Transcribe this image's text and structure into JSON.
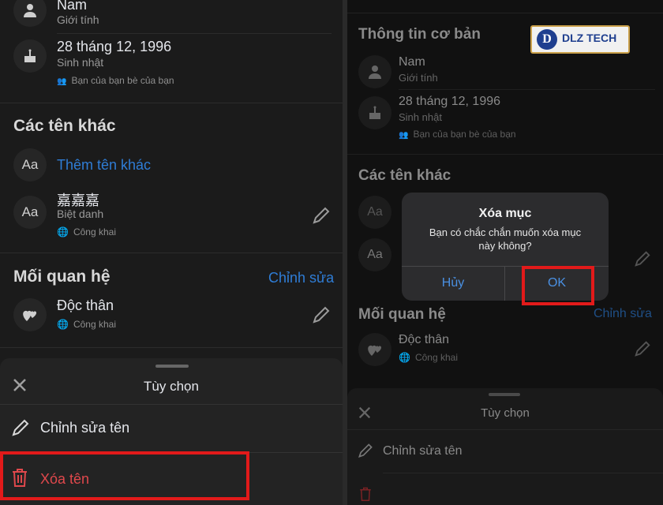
{
  "left": {
    "gender": {
      "value": "Nam",
      "label": "Giới tính"
    },
    "birthday": {
      "value": "28 tháng 12, 1996",
      "label": "Sinh nhật",
      "privacy": "Bạn của bạn bè của bạn"
    },
    "other_names": {
      "title": "Các tên khác",
      "add_label": "Thêm tên khác",
      "nickname": {
        "value": "嘉嘉嘉",
        "label": "Biệt danh",
        "privacy": "Công khai"
      }
    },
    "relationship": {
      "title": "Mối quan hệ",
      "edit_label": "Chỉnh sửa",
      "value": "Độc thân",
      "privacy": "Công khai"
    },
    "sheet": {
      "title": "Tùy chọn",
      "edit_name": "Chỉnh sửa tên",
      "delete_name": "Xóa tên"
    }
  },
  "right": {
    "logo_text": "DLZ TECH",
    "basic_info_title": "Thông tin cơ bản",
    "gender": {
      "value": "Nam",
      "label": "Giới tính"
    },
    "birthday": {
      "value": "28 tháng 12, 1996",
      "label": "Sinh nhật",
      "privacy": "Bạn của bạn bè của bạn"
    },
    "other_names_title": "Các tên khác",
    "relationship": {
      "title": "Mối quan hệ",
      "edit_label": "Chỉnh sửa",
      "value": "Độc thân",
      "privacy": "Công khai"
    },
    "dialog": {
      "title": "Xóa mục",
      "message": "Bạn có chắc chắn muốn xóa mục này không?",
      "cancel": "Hủy",
      "ok": "OK"
    },
    "sheet": {
      "title": "Tùy chọn",
      "edit_name": "Chỉnh sửa tên"
    }
  },
  "colors": {
    "accent": "#2f7dd6",
    "danger": "#e21a1a",
    "delete_text": "#e0484c"
  },
  "icons": [
    "person-icon",
    "cake-icon",
    "friends-icon",
    "text-aa-icon",
    "globe-icon",
    "pencil-icon",
    "hearts-icon",
    "close-icon",
    "trash-icon"
  ]
}
